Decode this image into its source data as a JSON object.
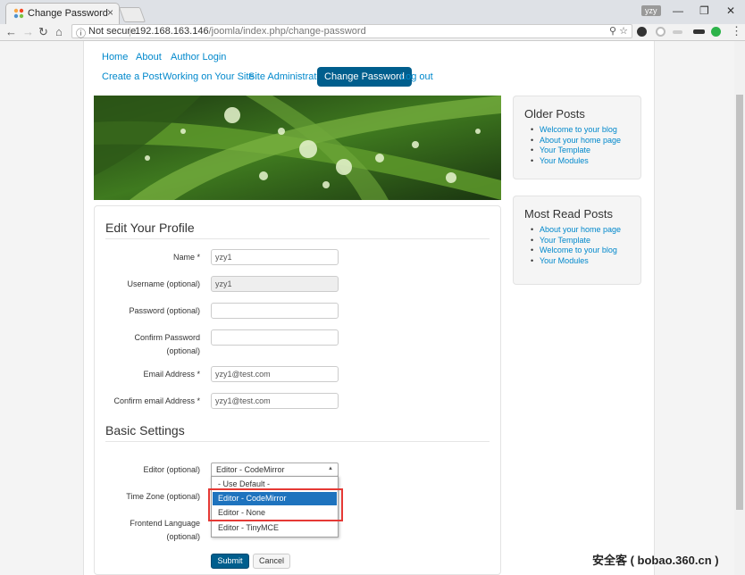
{
  "browser": {
    "tab_title": "Change Password",
    "tab_close": "×",
    "user_badge": "yzy",
    "security": "Not secure",
    "url_host": "192.168.163.146",
    "url_path": "/joomla/index.php/change-password",
    "win_min": "—",
    "win_max": "❐",
    "win_close": "✕"
  },
  "menu": {
    "row1": [
      "Home",
      "About",
      "Author Login"
    ],
    "row2": [
      "Create a Post",
      "Working on Your Site",
      "Site Administrator",
      "Change Password",
      "Log out"
    ]
  },
  "profile": {
    "heading": "Edit Your Profile",
    "fields": [
      {
        "label": "Name *",
        "value": ""
      },
      {
        "label": "Username (optional)",
        "value": "yzy1"
      },
      {
        "label": "Password (optional)",
        "value": ""
      },
      {
        "label": "Confirm Password",
        "label2": "(optional)",
        "value": ""
      },
      {
        "label": "Email Address *",
        "value": "yzy1@test.com"
      },
      {
        "label": "Confirm email Address *",
        "value": "yzy1@test.com"
      }
    ],
    "name_value": "yzy1"
  },
  "basic": {
    "heading": "Basic Settings",
    "editor_label": "Editor (optional)",
    "timezone_label": "Time Zone (optional)",
    "language_label": "Frontend Language",
    "language_label2": "(optional)",
    "editor_selected": "Editor - CodeMirror",
    "editor_options": [
      "- Use Default -",
      "Editor - CodeMirror",
      "Editor - None",
      "Editor - TinyMCE"
    ]
  },
  "buttons": {
    "submit": "Submit",
    "cancel": "Cancel"
  },
  "sidebar": {
    "older_title": "Older Posts",
    "older_items": [
      "Welcome to your blog",
      "About your home page",
      "Your Template",
      "Your Modules"
    ],
    "most_title": "Most Read Posts",
    "most_items": [
      "About your home page",
      "Your Template",
      "Welcome to your blog",
      "Your Modules"
    ]
  },
  "watermark": "安全客 ( bobao.360.cn )",
  "colors": {
    "accent": "#005e8d",
    "link": "#0088cc",
    "highlight": "#1e73be",
    "callout": "#e53935"
  }
}
